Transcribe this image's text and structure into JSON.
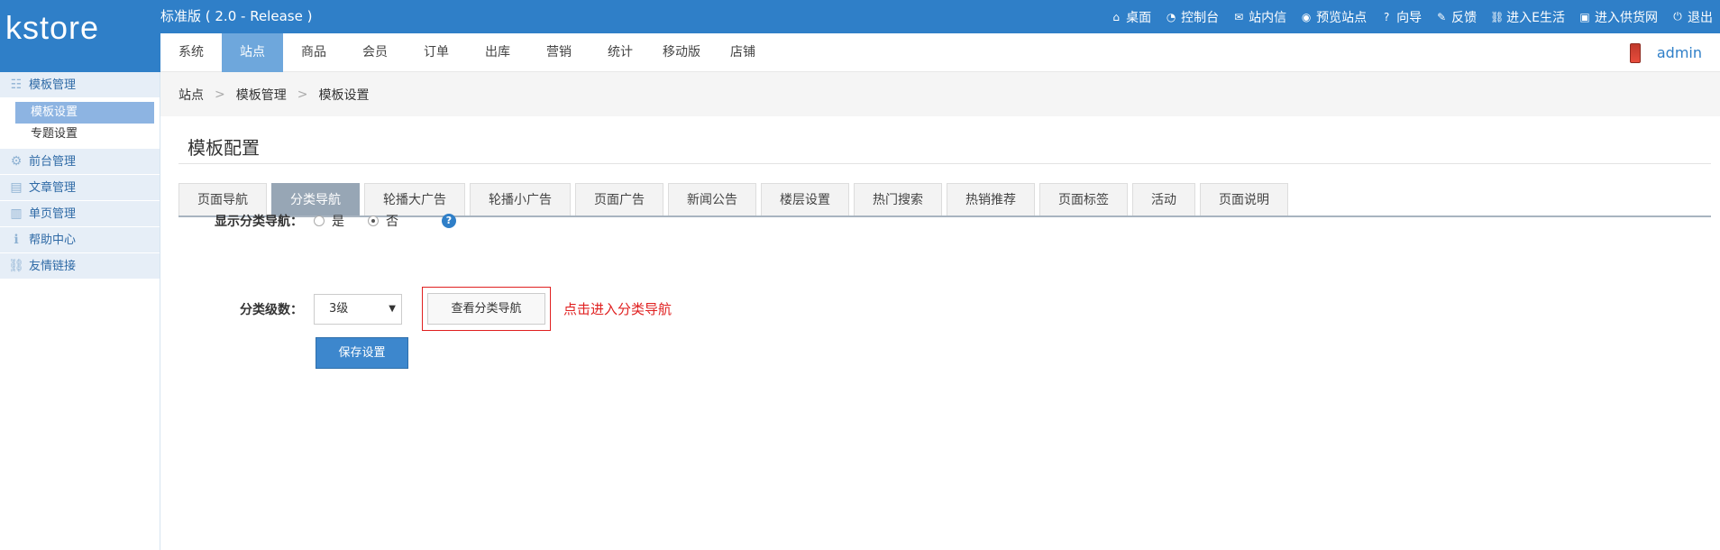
{
  "app": {
    "logo": "kstore",
    "version": "标准版 ( 2.0 - Release )"
  },
  "toplinks": [
    {
      "label": "桌面",
      "icon": "home-icon",
      "glyph": "⌂"
    },
    {
      "label": "控制台",
      "icon": "dashboard-icon",
      "glyph": "◔"
    },
    {
      "label": "站内信",
      "icon": "mail-icon",
      "glyph": "✉"
    },
    {
      "label": "预览站点",
      "icon": "eye-icon",
      "glyph": "◉"
    },
    {
      "label": "向导",
      "icon": "question-icon",
      "glyph": "?"
    },
    {
      "label": "反馈",
      "icon": "edit-icon",
      "glyph": "✎"
    },
    {
      "label": "进入E生活",
      "icon": "link-icon",
      "glyph": "⛓"
    },
    {
      "label": "进入供货网",
      "icon": "inbox-icon",
      "glyph": "▣"
    },
    {
      "label": "退出",
      "icon": "power-icon",
      "glyph": "⏻"
    }
  ],
  "menu": [
    {
      "label": "系统"
    },
    {
      "label": "站点",
      "active": true
    },
    {
      "label": "商品"
    },
    {
      "label": "会员"
    },
    {
      "label": "订单"
    },
    {
      "label": "出库"
    },
    {
      "label": "营销"
    },
    {
      "label": "统计"
    },
    {
      "label": "移动版"
    },
    {
      "label": "店铺"
    }
  ],
  "user": {
    "name": "admin"
  },
  "sidebar": {
    "groups": [
      {
        "label": "模板管理",
        "icon": "list-icon",
        "glyph": "☷",
        "items": [
          {
            "label": "模板设置",
            "active": true
          },
          {
            "label": "专题设置"
          }
        ]
      },
      {
        "label": "前台管理",
        "icon": "gear-icon",
        "glyph": "⚙"
      },
      {
        "label": "文章管理",
        "icon": "document-icon",
        "glyph": "▤"
      },
      {
        "label": "单页管理",
        "icon": "page-icon",
        "glyph": "▥"
      },
      {
        "label": "帮助中心",
        "icon": "info-icon",
        "glyph": "ℹ"
      },
      {
        "label": "友情链接",
        "icon": "chain-icon",
        "glyph": "⛓"
      }
    ]
  },
  "breadcrumb": [
    "站点",
    "模板管理",
    "模板设置"
  ],
  "breadcrumb_sep": ">",
  "page_title": "模板配置",
  "tabs": [
    {
      "label": "页面导航"
    },
    {
      "label": "分类导航",
      "active": true
    },
    {
      "label": "轮播大广告"
    },
    {
      "label": "轮播小广告"
    },
    {
      "label": "页面广告"
    },
    {
      "label": "新闻公告"
    },
    {
      "label": "楼层设置"
    },
    {
      "label": "热门搜索"
    },
    {
      "label": "热销推荐"
    },
    {
      "label": "页面标签"
    },
    {
      "label": "活动"
    },
    {
      "label": "页面说明"
    }
  ],
  "form": {
    "show_nav_label": "显示分类导航：",
    "radio_yes": "是",
    "radio_no": "否",
    "selected": "否",
    "help": "?",
    "level_label": "分类级数：",
    "level_value": "3级",
    "view_button": "查看分类导航",
    "hint": "点击进入分类导航",
    "save_button": "保存设置"
  }
}
